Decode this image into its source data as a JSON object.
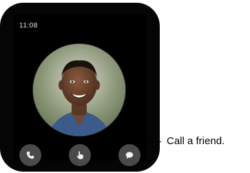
{
  "watch": {
    "time": "11:08"
  },
  "actions": [
    {
      "icon": "phone-icon"
    },
    {
      "icon": "hand-tap-icon"
    },
    {
      "icon": "message-icon"
    }
  ],
  "callout": {
    "text": "Call a friend."
  }
}
